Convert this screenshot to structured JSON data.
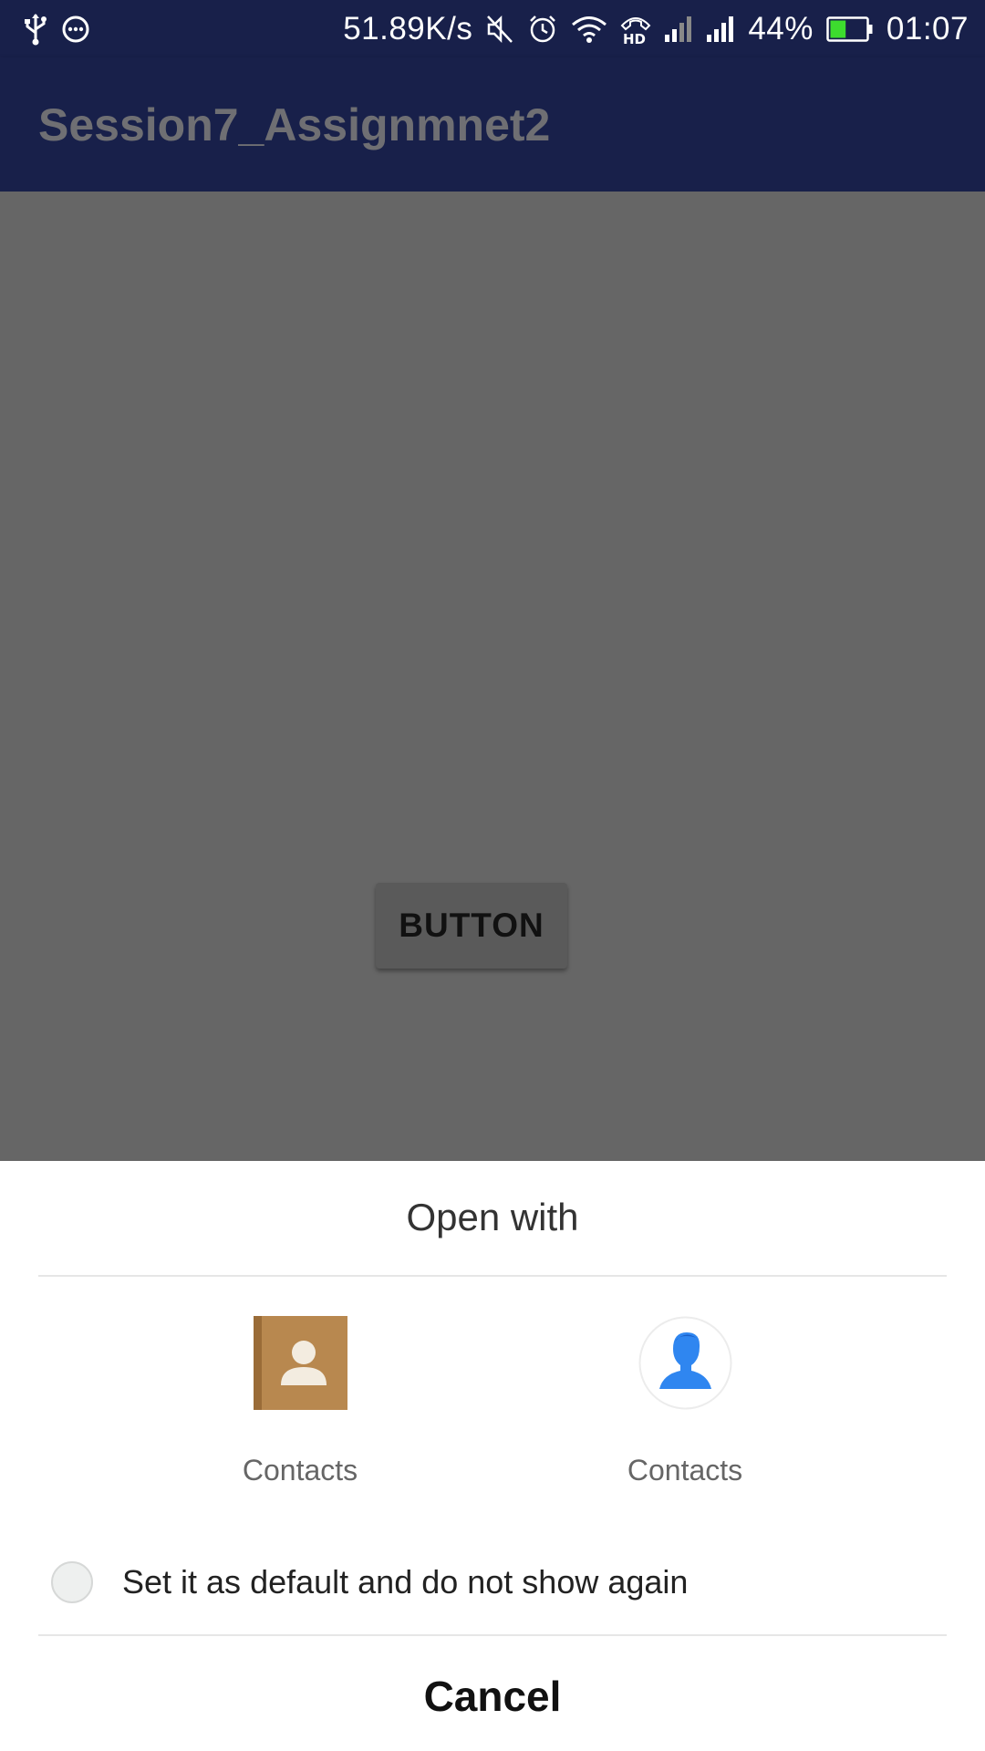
{
  "status_bar": {
    "net_speed": "51.89K/s",
    "battery_percent": "44%",
    "battery_level": 0.44,
    "time": "01:07",
    "icons_left": [
      "usb-icon",
      "chat-bubble-icon"
    ],
    "icons_right": [
      "mute-icon",
      "alarm-icon",
      "wifi-icon",
      "hd-call-icon",
      "signal-icon",
      "signal-icon",
      "battery-icon"
    ]
  },
  "app_bar": {
    "title": "Session7_Assignmnet2"
  },
  "content": {
    "button_label": "BUTTON"
  },
  "sheet": {
    "title": "Open with",
    "options": [
      {
        "label": "Contacts",
        "icon": "contacts-book-icon"
      },
      {
        "label": "Contacts",
        "icon": "contacts-person-icon"
      }
    ],
    "default_label": "Set it as default and do not show again",
    "cancel_label": "Cancel"
  },
  "colors": {
    "bar_bg": "#18204a",
    "overlay": "#666666",
    "battery_fill": "#3ddc2e",
    "contacts_book": "#b8884f",
    "contacts_person": "#2f86f0"
  }
}
